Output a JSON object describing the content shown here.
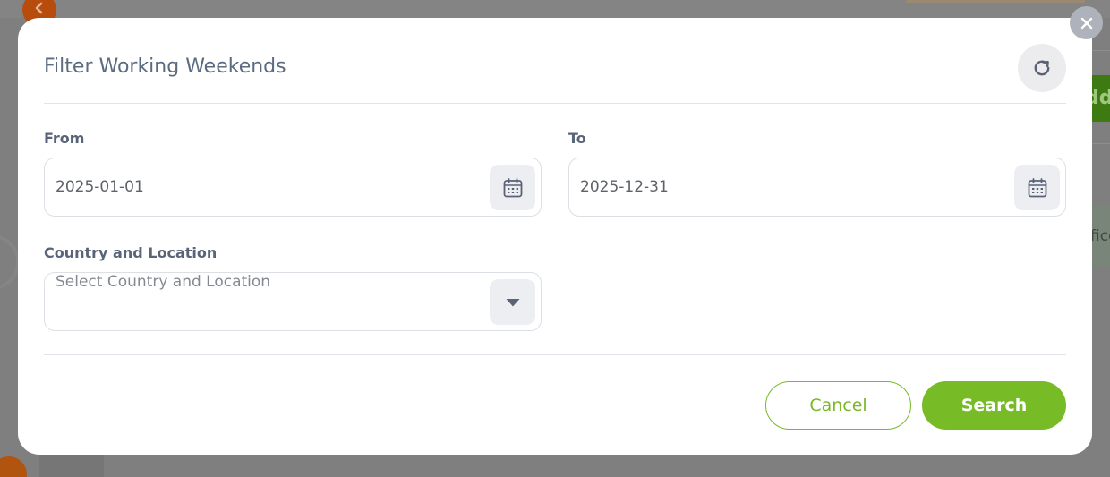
{
  "modal": {
    "title": "Filter Working Weekends",
    "refresh_icon": "refresh-icon",
    "close_icon": "close-icon"
  },
  "fields": {
    "from": {
      "label": "From",
      "value": "2025-01-01",
      "icon": "calendar-icon"
    },
    "to": {
      "label": "To",
      "value": "2025-12-31",
      "icon": "calendar-icon"
    },
    "country_location": {
      "label": "Country and Location",
      "placeholder": "Select Country and Location",
      "icon": "caret-down-icon"
    }
  },
  "actions": {
    "cancel_label": "Cancel",
    "search_label": "Search"
  },
  "background": {
    "add_button_fragment": "dd",
    "chip_fragment": "fice"
  },
  "colors": {
    "accent_green": "#77bb27",
    "back_button_orange": "#b84c0d"
  }
}
